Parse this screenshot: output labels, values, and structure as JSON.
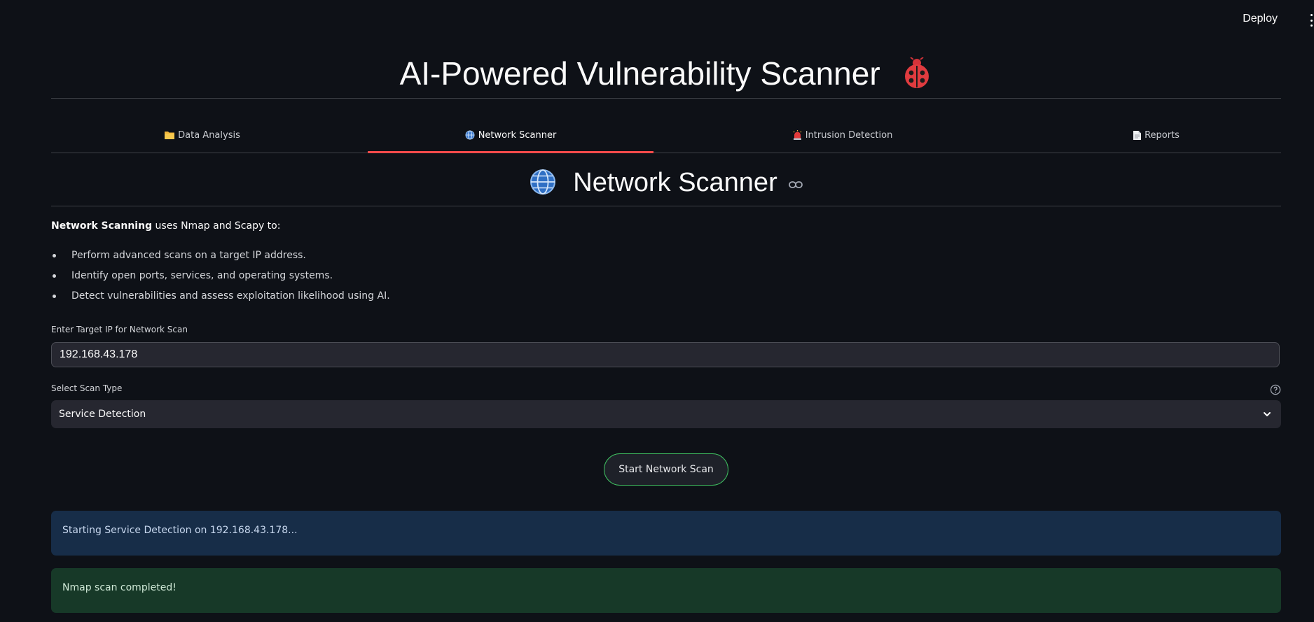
{
  "topbar": {
    "deploy_label": "Deploy"
  },
  "app": {
    "title": "AI-Powered Vulnerability Scanner",
    "title_icon": "ladybug-icon"
  },
  "tabs": [
    {
      "label": "Data Analysis",
      "icon": "folder-icon",
      "active": false
    },
    {
      "label": "Network Scanner",
      "icon": "globe-icon",
      "active": true
    },
    {
      "label": "Intrusion Detection",
      "icon": "siren-icon",
      "active": false
    },
    {
      "label": "Reports",
      "icon": "document-icon",
      "active": false
    }
  ],
  "section": {
    "title": "Network Scanner",
    "intro_bold": "Network Scanning",
    "intro_rest": " uses Nmap and Scapy to:",
    "bullets": [
      "Perform advanced scans on a target IP address.",
      "Identify open ports, services, and operating systems.",
      "Detect vulnerabilities and assess exploitation likelihood using AI."
    ]
  },
  "form": {
    "ip_label": "Enter Target IP for Network Scan",
    "ip_value": "192.168.43.178",
    "scan_type_label": "Select Scan Type",
    "scan_type_value": "Service Detection",
    "start_button": "Start Network Scan"
  },
  "alerts": {
    "info": "Starting Service Detection on 192.168.43.178...",
    "success": "Nmap scan completed!"
  },
  "colors": {
    "background": "#0e1117",
    "tab_active": "#ff4b4b",
    "button_border": "#3fbf60",
    "info_bg": "#172d48",
    "success_bg": "#173928"
  }
}
